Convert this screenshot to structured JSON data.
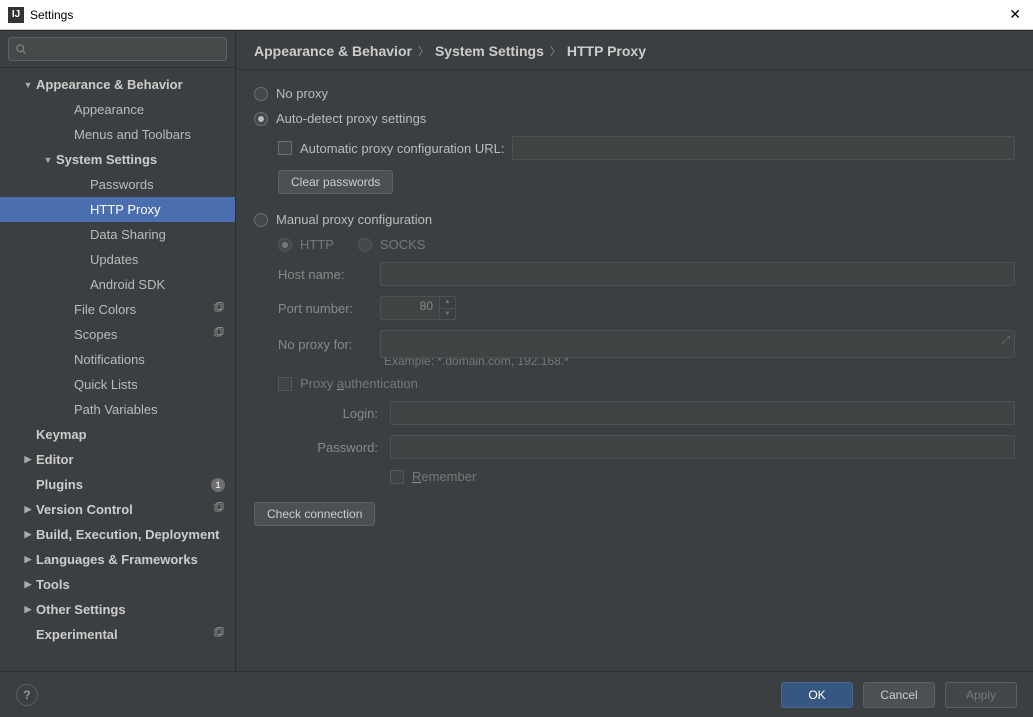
{
  "window": {
    "title": "Settings"
  },
  "search": {
    "placeholder": ""
  },
  "sidebar": [
    {
      "label": "Appearance & Behavior",
      "indent": 0,
      "bold": true,
      "arrow": "down"
    },
    {
      "label": "Appearance",
      "indent": 2,
      "arrow": "none"
    },
    {
      "label": "Menus and Toolbars",
      "indent": 2,
      "arrow": "none"
    },
    {
      "label": "System Settings",
      "indent": 1,
      "bold": true,
      "arrow": "down"
    },
    {
      "label": "Passwords",
      "indent": 3,
      "arrow": "none"
    },
    {
      "label": "HTTP Proxy",
      "indent": 3,
      "arrow": "none",
      "selected": true
    },
    {
      "label": "Data Sharing",
      "indent": 3,
      "arrow": "none"
    },
    {
      "label": "Updates",
      "indent": 3,
      "arrow": "none"
    },
    {
      "label": "Android SDK",
      "indent": 3,
      "arrow": "none"
    },
    {
      "label": "File Colors",
      "indent": 2,
      "arrow": "none",
      "trail": "copy"
    },
    {
      "label": "Scopes",
      "indent": 2,
      "arrow": "none",
      "trail": "copy"
    },
    {
      "label": "Notifications",
      "indent": 2,
      "arrow": "none"
    },
    {
      "label": "Quick Lists",
      "indent": 2,
      "arrow": "none"
    },
    {
      "label": "Path Variables",
      "indent": 2,
      "arrow": "none"
    },
    {
      "label": "Keymap",
      "indent": 0,
      "bold": true,
      "arrow": "blank"
    },
    {
      "label": "Editor",
      "indent": 0,
      "bold": true,
      "arrow": "right"
    },
    {
      "label": "Plugins",
      "indent": 0,
      "bold": true,
      "arrow": "blank",
      "trail": "badge",
      "badge": "1"
    },
    {
      "label": "Version Control",
      "indent": 0,
      "bold": true,
      "arrow": "right",
      "trail": "copy"
    },
    {
      "label": "Build, Execution, Deployment",
      "indent": 0,
      "bold": true,
      "arrow": "right"
    },
    {
      "label": "Languages & Frameworks",
      "indent": 0,
      "bold": true,
      "arrow": "right"
    },
    {
      "label": "Tools",
      "indent": 0,
      "bold": true,
      "arrow": "right"
    },
    {
      "label": "Other Settings",
      "indent": 0,
      "bold": true,
      "arrow": "right"
    },
    {
      "label": "Experimental",
      "indent": 0,
      "bold": true,
      "arrow": "blank",
      "trail": "copy"
    }
  ],
  "breadcrumb": [
    "Appearance & Behavior",
    "System Settings",
    "HTTP Proxy"
  ],
  "form": {
    "no_proxy": "No proxy",
    "auto_detect": "Auto-detect proxy settings",
    "auto_url_label": "Automatic proxy configuration URL:",
    "clear_passwords": "Clear passwords",
    "manual": "Manual proxy configuration",
    "http": "HTTP",
    "socks": "SOCKS",
    "host_label": "Host name:",
    "port_label": "Port number:",
    "port_value": "80",
    "noproxy_label": "No proxy for:",
    "example": "Example: *.domain.com, 192.168.*",
    "proxy_auth": "Proxy authentication",
    "login_label": "Login:",
    "password_label": "Password:",
    "remember": "Remember",
    "check_connection": "Check connection"
  },
  "footer": {
    "ok": "OK",
    "cancel": "Cancel",
    "apply": "Apply"
  }
}
